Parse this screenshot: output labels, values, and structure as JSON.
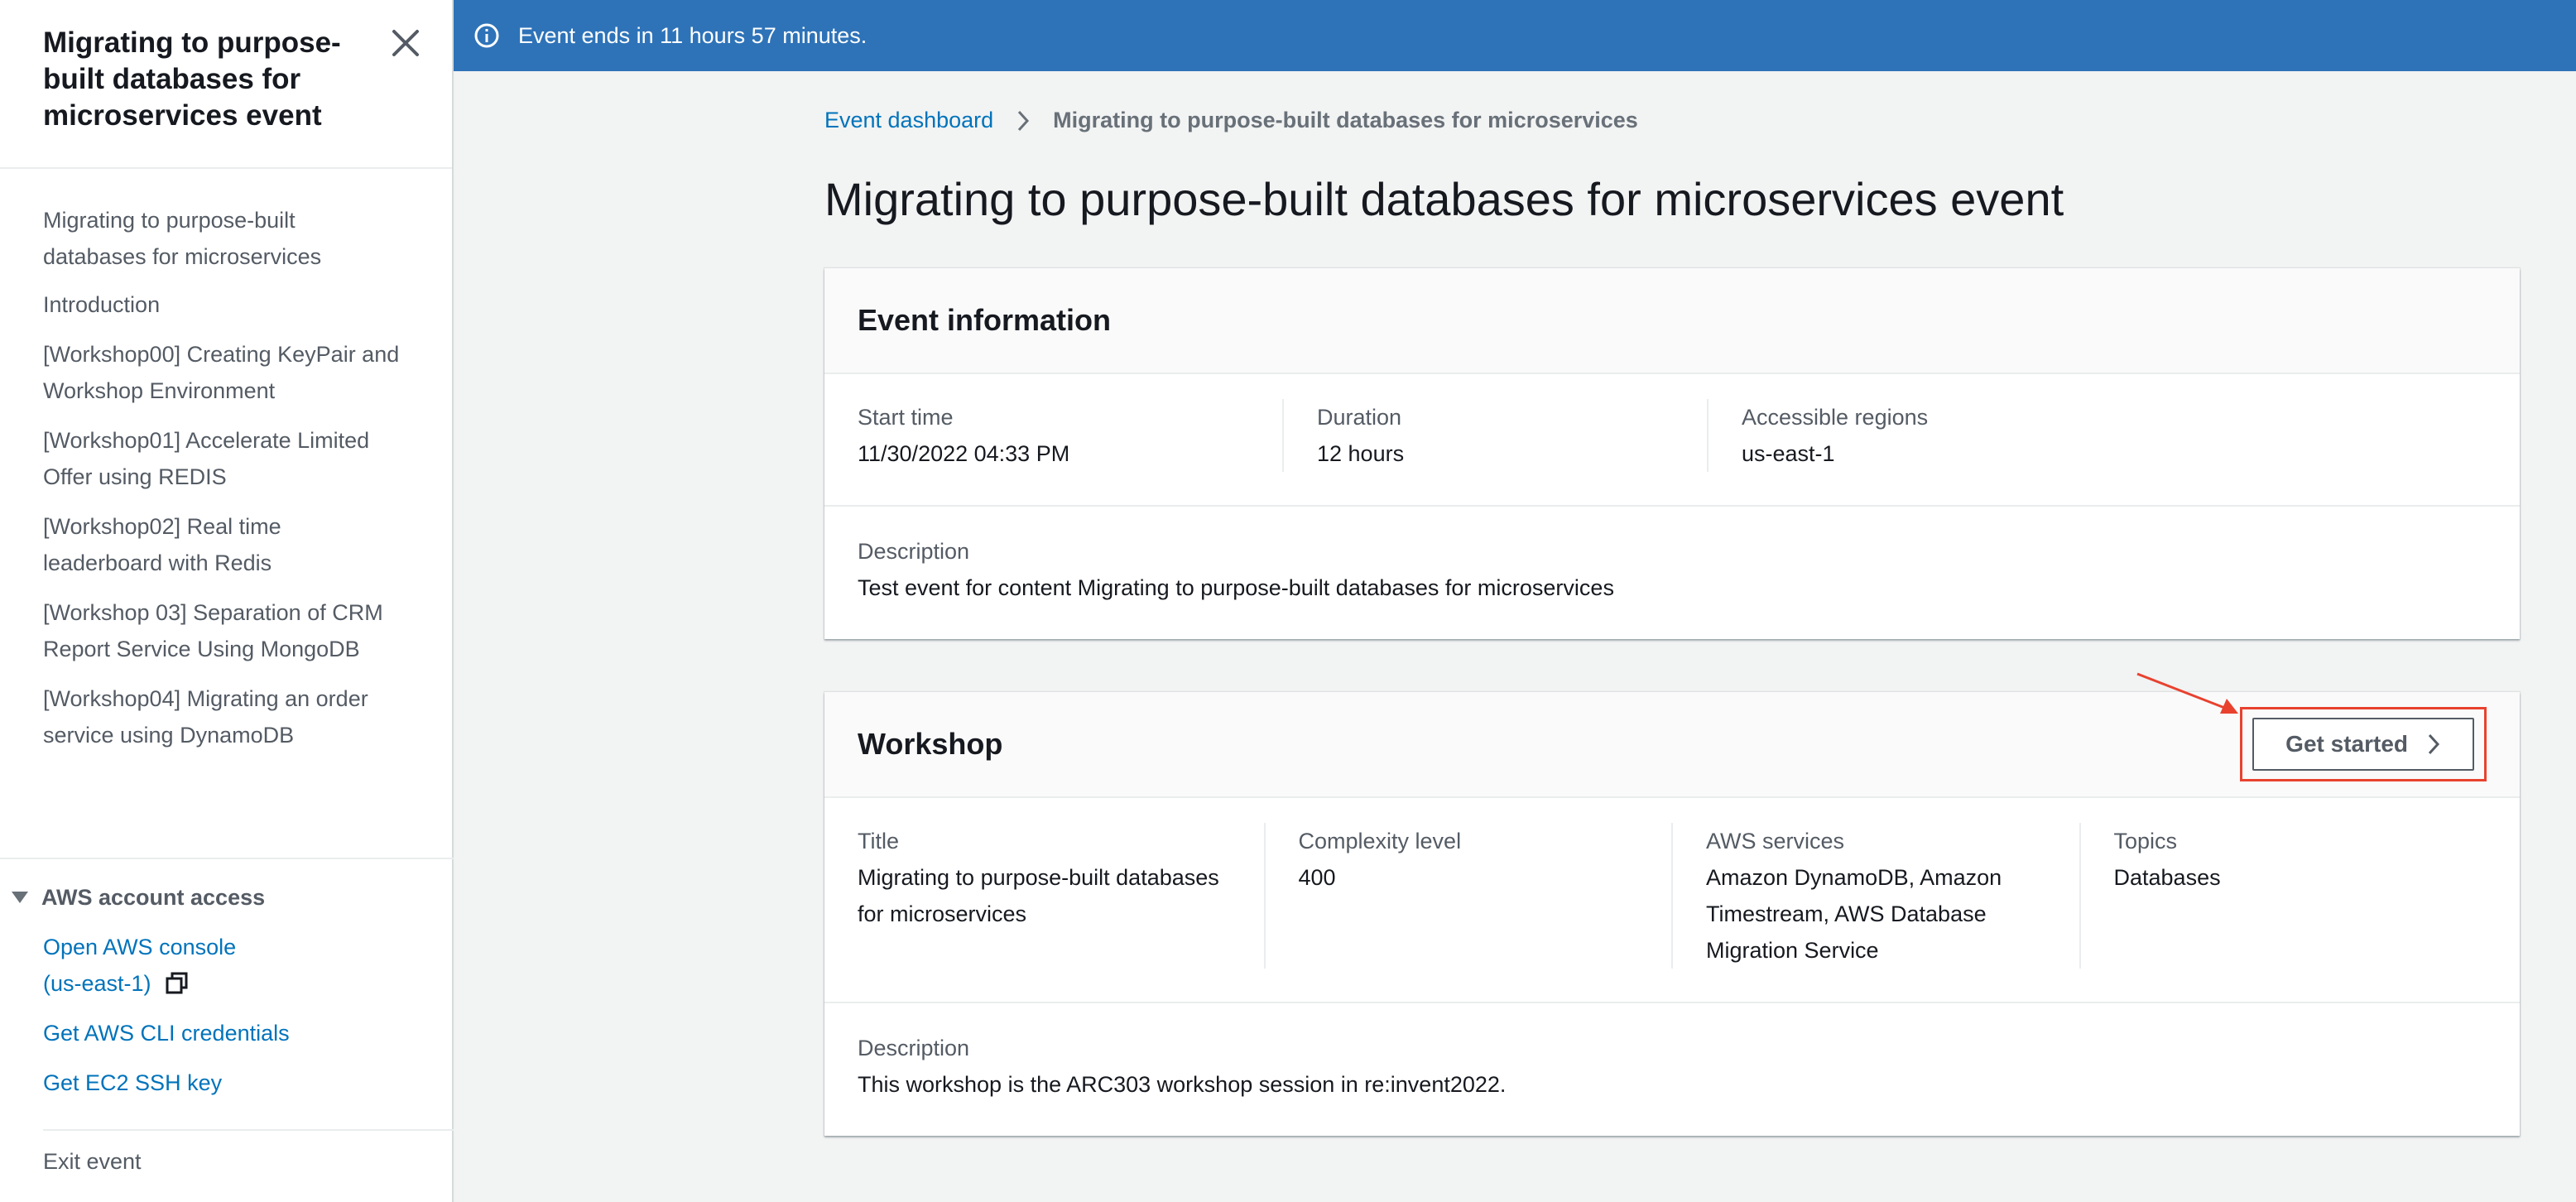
{
  "sidebar": {
    "title": "Migrating to purpose-built databases for microservices event",
    "nav": [
      "Migrating to purpose-built databases for microservices",
      "Introduction",
      "[Workshop00] Creating KeyPair and Workshop Environment",
      "[Workshop01] Accelerate Limited Offer using REDIS",
      "[Workshop02] Real time leaderboard with Redis",
      "[Workshop 03] Separation of CRM Report Service Using MongoDB",
      "[Workshop04] Migrating an order service using DynamoDB"
    ],
    "account_access": {
      "heading": "AWS account access",
      "console_link": "Open AWS console",
      "console_region": "(us-east-1)",
      "cli_link": "Get AWS CLI credentials",
      "ssh_link": "Get EC2 SSH key"
    },
    "exit": "Exit event"
  },
  "flash": {
    "message": "Event ends in 11 hours 57 minutes."
  },
  "breadcrumb": {
    "root": "Event dashboard",
    "current": "Migrating to purpose-built databases for microservices"
  },
  "page_title": "Migrating to purpose-built databases for microservices event",
  "event_info": {
    "title": "Event information",
    "start_time_label": "Start time",
    "start_time": "11/30/2022 04:33 PM",
    "duration_label": "Duration",
    "duration": "12 hours",
    "regions_label": "Accessible regions",
    "regions": "us-east-1",
    "description_label": "Description",
    "description": "Test event for content Migrating to purpose-built databases for microservices"
  },
  "workshop": {
    "title": "Workshop",
    "get_started": "Get started",
    "title_label": "Title",
    "title_value": "Migrating to purpose-built databases for microservices",
    "complexity_label": "Complexity level",
    "complexity": "400",
    "services_label": "AWS services",
    "services": "Amazon DynamoDB, Amazon Timestream, AWS Database Migration Service",
    "topics_label": "Topics",
    "topics": "Databases",
    "description_label": "Description",
    "description": "This workshop is the ARC303 workshop session in re:invent2022."
  },
  "colors": {
    "flash_bg": "#2e73b8",
    "link": "#0073bb",
    "highlight": "#e8422f"
  }
}
